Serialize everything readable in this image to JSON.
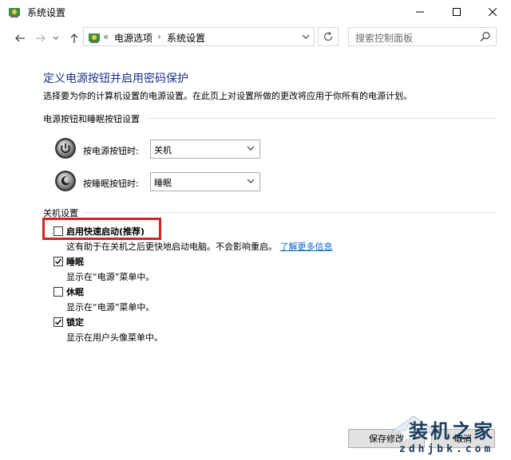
{
  "window": {
    "title": "系统设置",
    "minimize_icon": "minimize-icon",
    "maximize_icon": "maximize-icon",
    "close_icon": "close-icon"
  },
  "nav": {
    "breadcrumb_overflow": "«",
    "breadcrumbs": [
      "电源选项",
      "系统设置"
    ],
    "separator": "›",
    "search_placeholder": "搜索控制面板"
  },
  "page": {
    "heading": "定义电源按钮并启用密码保护",
    "description": "选择要为你的计算机设置的电源设置。在此页上对设置所做的更改将应用于你所有的电源计划。",
    "buttons_section": "电源按钮和睡眠按钮设置",
    "power_button_label": "按电源按钮时:",
    "power_button_value": "关机",
    "sleep_button_label": "按睡眠按钮时:",
    "sleep_button_value": "睡眠",
    "shutdown_section": "关机设置"
  },
  "options": [
    {
      "label": "启用快速启动(推荐)",
      "checked": false,
      "desc": "这有助于在关机之后更快地启动电脑。不会影响重启。",
      "link": "了解更多信息"
    },
    {
      "label": "睡眠",
      "checked": true,
      "desc": "显示在“电源”菜单中。"
    },
    {
      "label": "休眠",
      "checked": false,
      "desc": "显示在“电源”菜单中。"
    },
    {
      "label": "锁定",
      "checked": true,
      "desc": "显示在用户头像菜单中。"
    }
  ],
  "footer": {
    "save": "保存修改",
    "cancel": "取消"
  },
  "watermark": {
    "text": "装机之家",
    "url": "zdhjbk.com"
  },
  "colors": {
    "heading": "#1e3287",
    "link": "#0066cc",
    "highlight": "#d32222"
  }
}
